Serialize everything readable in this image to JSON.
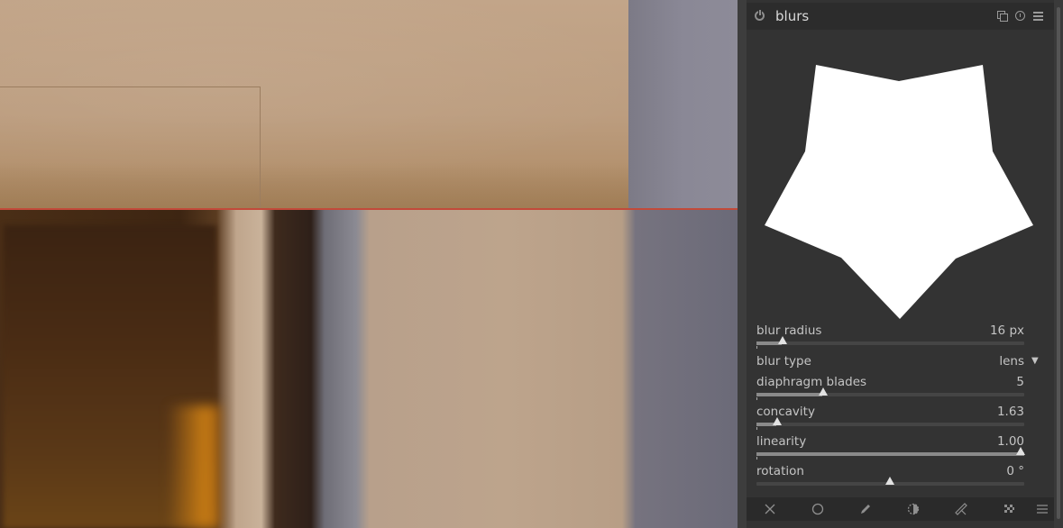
{
  "module": {
    "title": "blurs",
    "icons": [
      "power-icon",
      "multi-instance-icon",
      "reset-icon",
      "presets-icon"
    ]
  },
  "preview": {
    "shape": "five-blade diaphragm"
  },
  "sliders": [
    {
      "label": "blur radius",
      "value": "16 px",
      "fraction": 0.09
    },
    {
      "label": "diaphragm blades",
      "value": "5",
      "fraction": 0.25
    },
    {
      "label": "concavity",
      "value": "1.63",
      "fraction": 0.07
    },
    {
      "label": "linearity",
      "value": "1.00",
      "fraction": 1.0
    },
    {
      "label": "rotation",
      "value": "0 °",
      "fraction": 0.5
    }
  ],
  "combo": {
    "label": "blur type",
    "value": "lens"
  },
  "mask_toolbar": {
    "icons": [
      "off-icon",
      "circle-icon",
      "pen-icon",
      "gradient-icon",
      "brush-icon",
      "parametric-icon",
      "menu-icon"
    ]
  },
  "colors": {
    "panel_bg": "#333333",
    "split_line": "#c24a3a",
    "text": "#c4c4c4"
  }
}
